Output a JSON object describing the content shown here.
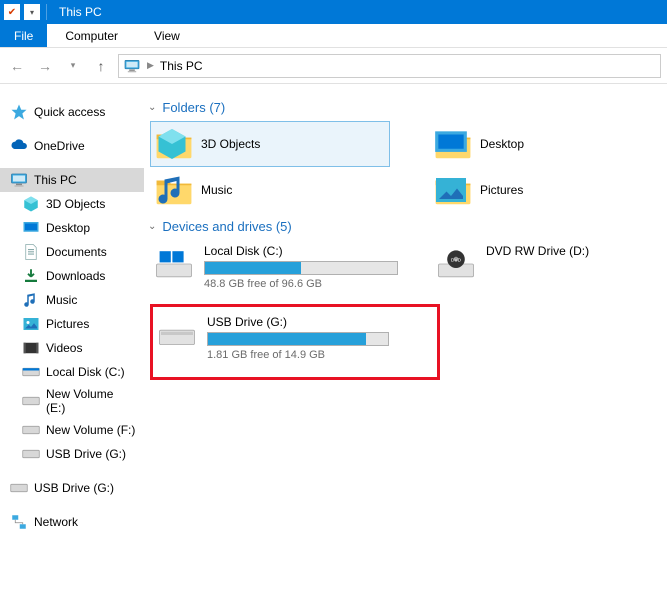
{
  "window": {
    "title": "This PC"
  },
  "ribbon": {
    "file": "File",
    "tabs": [
      "Computer",
      "View"
    ]
  },
  "breadcrumb": {
    "location": "This PC"
  },
  "sidebar": {
    "quick_access": "Quick access",
    "onedrive": "OneDrive",
    "this_pc": "This PC",
    "this_pc_children": [
      "3D Objects",
      "Desktop",
      "Documents",
      "Downloads",
      "Music",
      "Pictures",
      "Videos",
      "Local Disk (C:)",
      "New Volume (E:)",
      "New Volume (F:)",
      "USB Drive (G:)"
    ],
    "usb_detached": "USB Drive (G:)",
    "network": "Network"
  },
  "groups": {
    "folders": {
      "label": "Folders (7)"
    },
    "drives": {
      "label": "Devices and drives (5)"
    }
  },
  "folders": [
    {
      "name": "3D Objects"
    },
    {
      "name": "Desktop"
    },
    {
      "name": "Music"
    },
    {
      "name": "Pictures"
    }
  ],
  "drives_list": [
    {
      "name": "Local Disk (C:)",
      "free_text": "48.8 GB free of 96.6 GB",
      "fill_pct": 50
    },
    {
      "name": "DVD RW Drive (D:)"
    },
    {
      "name": "USB Drive (G:)",
      "free_text": "1.81 GB free of 14.9 GB",
      "fill_pct": 88,
      "highlight": true
    }
  ]
}
